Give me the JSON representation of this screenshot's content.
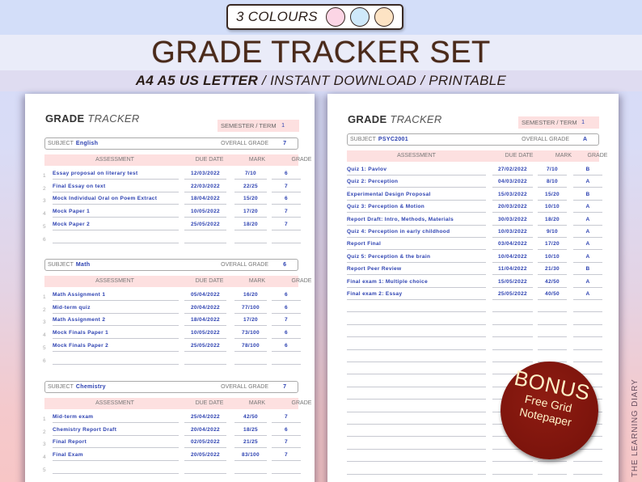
{
  "banner": {
    "colours_label": "3 COLOURS",
    "swatches": [
      {
        "name": "pink",
        "color": "#fcd5e5"
      },
      {
        "name": "blue",
        "color": "#cfe9fb"
      },
      {
        "name": "peach",
        "color": "#fde3c4"
      }
    ],
    "title": "GRADE TRACKER SET",
    "subtitle_bold": "A4 A5 US LETTER",
    "subtitle_rest": " / INSTANT DOWNLOAD / PRINTABLE"
  },
  "labels": {
    "title_bold": "GRADE",
    "title_italic": " TRACKER",
    "semester": "SEMESTER / TERM",
    "subject": "SUBJECT",
    "overall_grade": "OVERALL GRADE",
    "col_assessment": "ASSESSMENT",
    "col_due": "DUE DATE",
    "col_mark": "MARK",
    "col_grade": "GRADE"
  },
  "left_page": {
    "semester_value": "1",
    "subjects": [
      {
        "subject": "English",
        "overall_grade": "7",
        "rows": [
          {
            "n": "1",
            "assessment": "Essay proposal on literary test",
            "due": "12/03/2022",
            "mark": "7/10",
            "grade": "6"
          },
          {
            "n": "2",
            "assessment": "Final Essay on text",
            "due": "22/03/2022",
            "mark": "22/25",
            "grade": "7"
          },
          {
            "n": "3",
            "assessment": "Mock Individual Oral on Poem Extract",
            "due": "18/04/2022",
            "mark": "15/20",
            "grade": "6"
          },
          {
            "n": "4",
            "assessment": "Mock Paper 1",
            "due": "10/05/2022",
            "mark": "17/20",
            "grade": "7"
          },
          {
            "n": "5",
            "assessment": "Mock Paper 2",
            "due": "25/05/2022",
            "mark": "18/20",
            "grade": "7"
          },
          {
            "n": "6",
            "assessment": "",
            "due": "",
            "mark": "",
            "grade": ""
          }
        ]
      },
      {
        "subject": "Math",
        "overall_grade": "6",
        "rows": [
          {
            "n": "1",
            "assessment": "Math Assignment 1",
            "due": "05/04/2022",
            "mark": "16/20",
            "grade": "6"
          },
          {
            "n": "2",
            "assessment": "Mid-term quiz",
            "due": "20/04/2022",
            "mark": "77/100",
            "grade": "6"
          },
          {
            "n": "3",
            "assessment": "Math Assignment 2",
            "due": "18/04/2022",
            "mark": "17/20",
            "grade": "7"
          },
          {
            "n": "4",
            "assessment": "Mock Finals Paper 1",
            "due": "10/05/2022",
            "mark": "73/100",
            "grade": "6"
          },
          {
            "n": "5",
            "assessment": "Mock Finals Paper 2",
            "due": "25/05/2022",
            "mark": "78/100",
            "grade": "6"
          },
          {
            "n": "6",
            "assessment": "",
            "due": "",
            "mark": "",
            "grade": ""
          }
        ]
      },
      {
        "subject": "Chemistry",
        "overall_grade": "7",
        "rows": [
          {
            "n": "1",
            "assessment": "Mid-term exam",
            "due": "25/04/2022",
            "mark": "42/50",
            "grade": "7"
          },
          {
            "n": "2",
            "assessment": "Chemistry Report Draft",
            "due": "20/04/2022",
            "mark": "18/25",
            "grade": "6"
          },
          {
            "n": "3",
            "assessment": "Final Report",
            "due": "02/05/2022",
            "mark": "21/25",
            "grade": "7"
          },
          {
            "n": "4",
            "assessment": "Final Exam",
            "due": "20/05/2022",
            "mark": "83/100",
            "grade": "7"
          },
          {
            "n": "5",
            "assessment": "",
            "due": "",
            "mark": "",
            "grade": ""
          }
        ]
      }
    ]
  },
  "right_page": {
    "semester_value": "1",
    "subject": "PSYC2001",
    "overall_grade": "A",
    "rows": [
      {
        "assessment": "Quiz 1: Pavlov",
        "due": "27/02/2022",
        "mark": "7/10",
        "grade": "B"
      },
      {
        "assessment": "Quiz 2: Perception",
        "due": "04/03/2022",
        "mark": "8/10",
        "grade": "A"
      },
      {
        "assessment": "Experimental Design Proposal",
        "due": "15/03/2022",
        "mark": "15/20",
        "grade": "B"
      },
      {
        "assessment": "Quiz 3: Perception & Motion",
        "due": "20/03/2022",
        "mark": "10/10",
        "grade": "A"
      },
      {
        "assessment": "Report Draft: Intro, Methods, Materials",
        "due": "30/03/2022",
        "mark": "18/20",
        "grade": "A"
      },
      {
        "assessment": "Quiz 4: Perception in early childhood",
        "due": "10/03/2022",
        "mark": "9/10",
        "grade": "A"
      },
      {
        "assessment": "Report Final",
        "due": "03/04/2022",
        "mark": "17/20",
        "grade": "A"
      },
      {
        "assessment": "Quiz 5: Perception & the brain",
        "due": "10/04/2022",
        "mark": "10/10",
        "grade": "A"
      },
      {
        "assessment": "Report Peer Review",
        "due": "11/04/2022",
        "mark": "21/30",
        "grade": "B"
      },
      {
        "assessment": "Final exam 1: Multiple choice",
        "due": "15/05/2022",
        "mark": "42/50",
        "grade": "A"
      },
      {
        "assessment": "Final exam 2: Essay",
        "due": "25/05/2022",
        "mark": "40/50",
        "grade": "A"
      }
    ],
    "blank_rows": 15
  },
  "bonus": {
    "line1": "BONUS",
    "line2": "Free Grid",
    "line3": "Notepaper"
  },
  "brand": "THE LEARNING DIARY"
}
